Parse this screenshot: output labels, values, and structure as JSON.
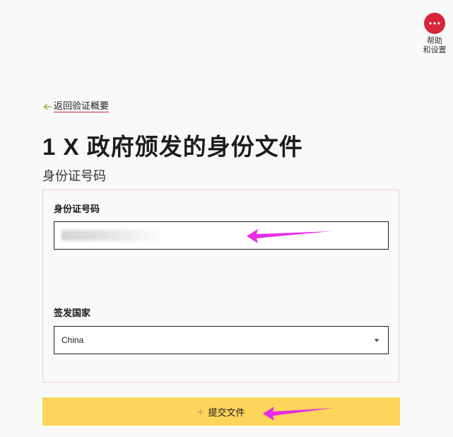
{
  "help": {
    "icon": "more-dots-icon",
    "label": "帮助\n和设置",
    "color": "#d8253a"
  },
  "back_link": {
    "label": "返回验证概要",
    "icon": "arrow-left-icon",
    "underline_color": "#d8253a",
    "arrow_color": "#8bb43a"
  },
  "page": {
    "title": "1 X 政府颁发的身份文件",
    "subtitle": "身份证号码"
  },
  "form": {
    "id_field": {
      "label": "身份证号码",
      "value": "420000/0 000"
    },
    "country_field": {
      "label": "签发国家",
      "selected": "China",
      "icon": "caret-down-icon"
    }
  },
  "submit": {
    "label": "提交文件",
    "icon": "plus-icon",
    "color": "#fdd55a"
  },
  "annotations": {
    "color": "#e62ee6"
  }
}
